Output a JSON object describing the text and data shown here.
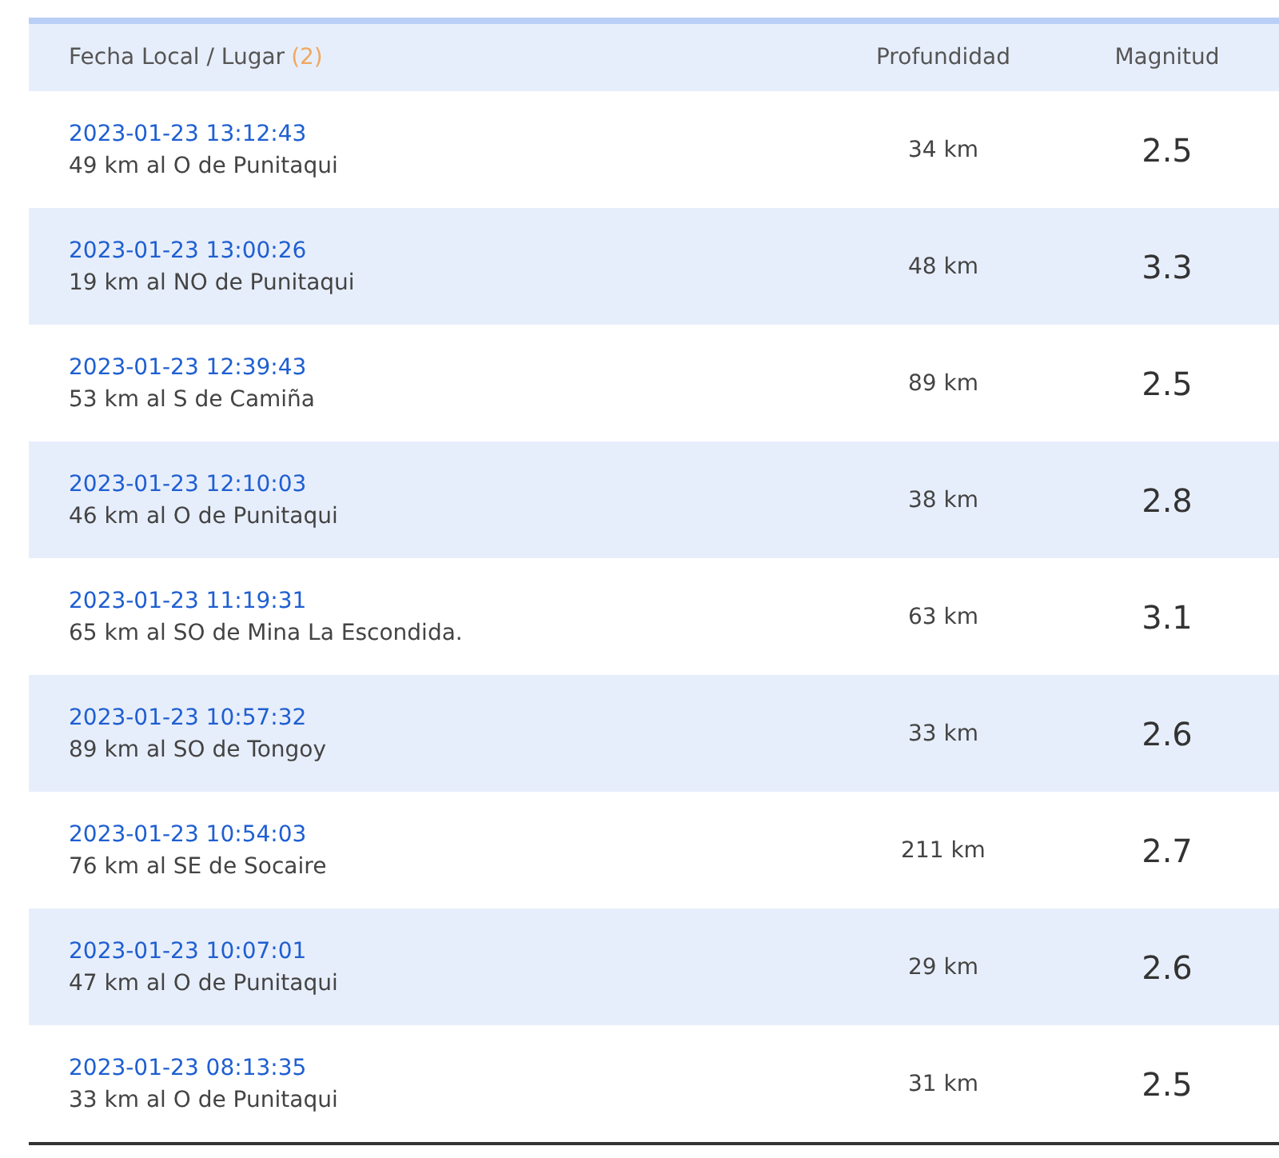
{
  "table": {
    "columns": [
      {
        "label": "Fecha Local / Lugar",
        "count": "(2)"
      },
      {
        "label": "Profundidad"
      },
      {
        "label": "Magnitud"
      }
    ],
    "rows": [
      {
        "date": "2023-01-23 13:12:43",
        "place": "49 km al O de Punitaqui",
        "depth": "34 km",
        "magnitude": "2.5"
      },
      {
        "date": "2023-01-23 13:00:26",
        "place": "19 km al NO de Punitaqui",
        "depth": "48 km",
        "magnitude": "3.3"
      },
      {
        "date": "2023-01-23 12:39:43",
        "place": "53 km al S de Camiña",
        "depth": "89 km",
        "magnitude": "2.5"
      },
      {
        "date": "2023-01-23 12:10:03",
        "place": "46 km al O de Punitaqui",
        "depth": "38 km",
        "magnitude": "2.8"
      },
      {
        "date": "2023-01-23 11:19:31",
        "place": "65 km al SO de Mina La Escondida.",
        "depth": "63 km",
        "magnitude": "3.1"
      },
      {
        "date": "2023-01-23 10:57:32",
        "place": "89 km al SO de Tongoy",
        "depth": "33 km",
        "magnitude": "2.6"
      },
      {
        "date": "2023-01-23 10:54:03",
        "place": "76 km al SE de Socaire",
        "depth": "211 km",
        "magnitude": "2.7"
      },
      {
        "date": "2023-01-23 10:07:01",
        "place": "47 km al O de Punitaqui",
        "depth": "29 km",
        "magnitude": "2.6"
      },
      {
        "date": "2023-01-23 08:13:35",
        "place": "33 km al O de Punitaqui",
        "depth": "31 km",
        "magnitude": "2.5"
      }
    ]
  }
}
